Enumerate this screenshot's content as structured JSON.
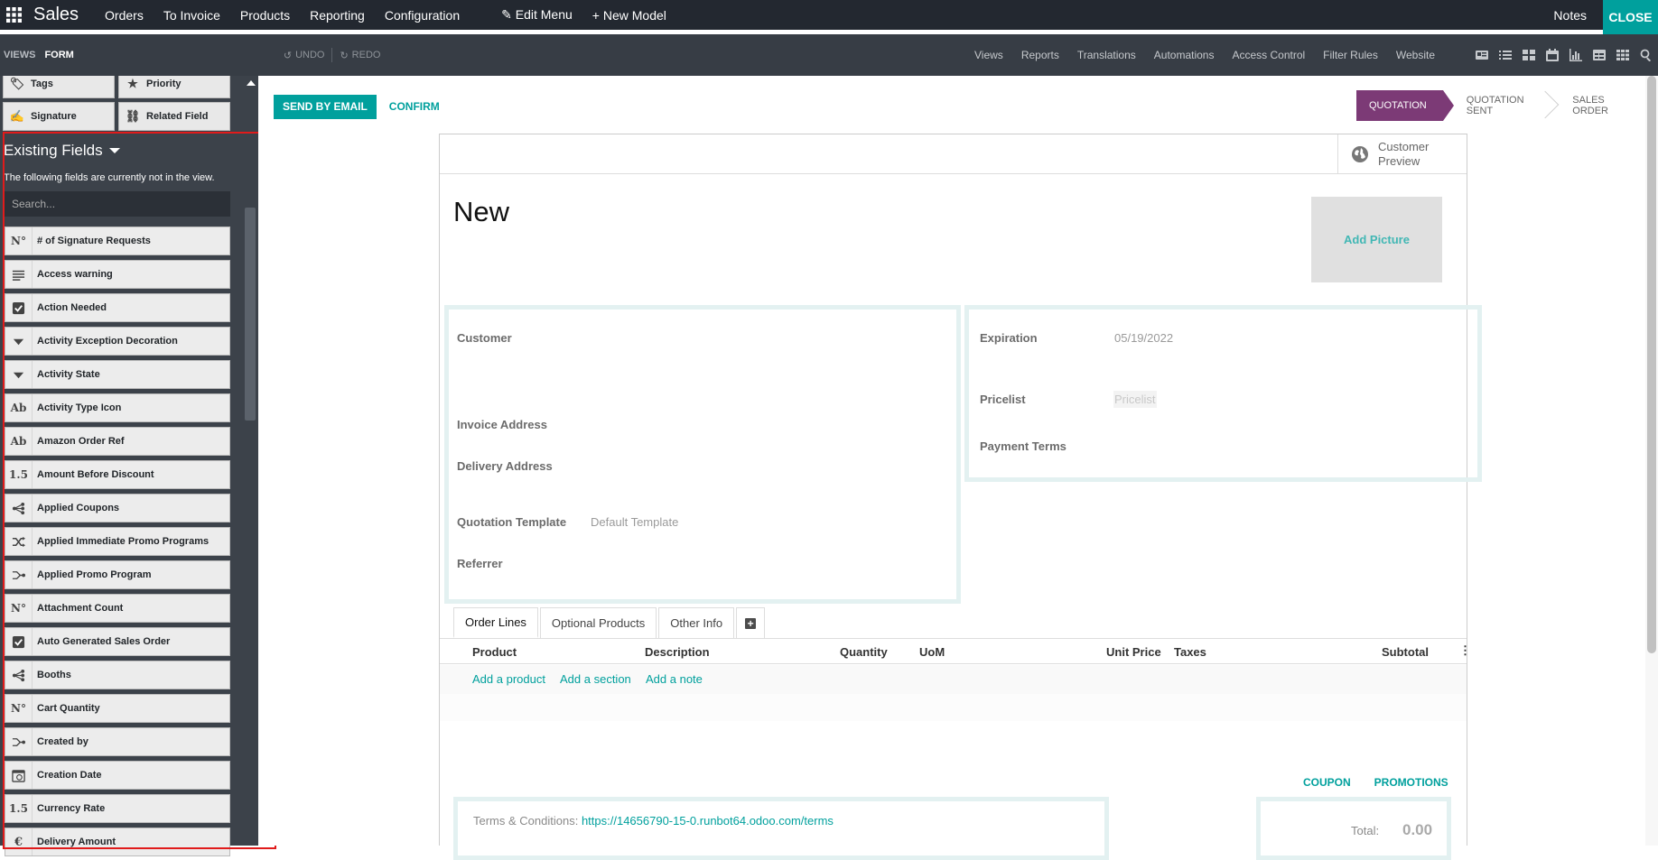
{
  "topbar": {
    "app_title": "Sales",
    "menu": [
      "Orders",
      "To Invoice",
      "Products",
      "Reporting",
      "Configuration"
    ],
    "edit_menu": "Edit Menu",
    "new_model": "New Model",
    "notes": "Notes",
    "close": "CLOSE"
  },
  "subbar": {
    "views_label": "VIEWS",
    "form_label": "FORM",
    "undo": "UNDO",
    "redo": "REDO",
    "menu": [
      "Views",
      "Reports",
      "Translations",
      "Automations",
      "Access Control",
      "Filter Rules",
      "Website"
    ],
    "view_icons": [
      "form-view-icon",
      "list-view-icon",
      "kanban-view-icon",
      "calendar-view-icon",
      "graph-view-icon",
      "pivot-view-icon",
      "grid-view-icon",
      "search-icon"
    ]
  },
  "sidebar": {
    "components": [
      {
        "label": "Tags",
        "icon": "tag-icon"
      },
      {
        "label": "Priority",
        "icon": "star-icon"
      },
      {
        "label": "Signature",
        "icon": "signature-icon"
      },
      {
        "label": "Related Field",
        "icon": "link-icon"
      }
    ],
    "existing_title": "Existing Fields",
    "existing_desc": "The following fields are currently not in the view.",
    "search_placeholder": "Search...",
    "fields": [
      {
        "label": "# of Signature Requests",
        "icon": "N°"
      },
      {
        "label": "Access warning",
        "icon": "text-icon"
      },
      {
        "label": "Action Needed",
        "icon": "checkbox-icon"
      },
      {
        "label": "Activity Exception Decoration",
        "icon": "selection-icon"
      },
      {
        "label": "Activity State",
        "icon": "selection-icon"
      },
      {
        "label": "Activity Type Icon",
        "icon": "Ab"
      },
      {
        "label": "Amazon Order Ref",
        "icon": "Ab"
      },
      {
        "label": "Amount Before Discount",
        "icon": "1.5"
      },
      {
        "label": "Applied Coupons",
        "icon": "many2many-icon"
      },
      {
        "label": "Applied Immediate Promo Programs",
        "icon": "shuffle-icon"
      },
      {
        "label": "Applied Promo Program",
        "icon": "many2one-icon"
      },
      {
        "label": "Attachment Count",
        "icon": "N°"
      },
      {
        "label": "Auto Generated Sales Order",
        "icon": "checkbox-icon"
      },
      {
        "label": "Booths",
        "icon": "many2many-icon"
      },
      {
        "label": "Cart Quantity",
        "icon": "N°"
      },
      {
        "label": "Created by",
        "icon": "many2one-icon"
      },
      {
        "label": "Creation Date",
        "icon": "datetime-icon"
      },
      {
        "label": "Currency Rate",
        "icon": "1.5"
      },
      {
        "label": "Delivery Amount",
        "icon": "monetary-icon"
      }
    ]
  },
  "form": {
    "send_by_email": "SEND BY EMAIL",
    "confirm": "CONFIRM",
    "stages": [
      "QUOTATION",
      "QUOTATION SENT",
      "SALES ORDER"
    ],
    "customer_preview": "Customer Preview",
    "title": "New",
    "add_picture": "Add Picture",
    "left_group": {
      "customer": "Customer",
      "invoice_address": "Invoice Address",
      "delivery_address": "Delivery Address",
      "quotation_template": "Quotation Template",
      "quotation_template_value": "Default Template",
      "referrer": "Referrer"
    },
    "right_group": {
      "expiration": "Expiration",
      "expiration_value": "05/19/2022",
      "pricelist": "Pricelist",
      "pricelist_placeholder": "Pricelist",
      "payment_terms": "Payment Terms"
    },
    "tabs": [
      "Order Lines",
      "Optional Products",
      "Other Info"
    ],
    "columns": [
      "Product",
      "Description",
      "Quantity",
      "UoM",
      "Unit Price",
      "Taxes",
      "Subtotal"
    ],
    "row_links": [
      "Add a product",
      "Add a section",
      "Add a note"
    ],
    "coupon": "COUPON",
    "promotions": "PROMOTIONS",
    "terms_label": "Terms & Conditions:",
    "terms_url": "https://14656790-15-0.runbot64.odoo.com/terms",
    "total_label": "Total:",
    "total_value": "0.00"
  }
}
